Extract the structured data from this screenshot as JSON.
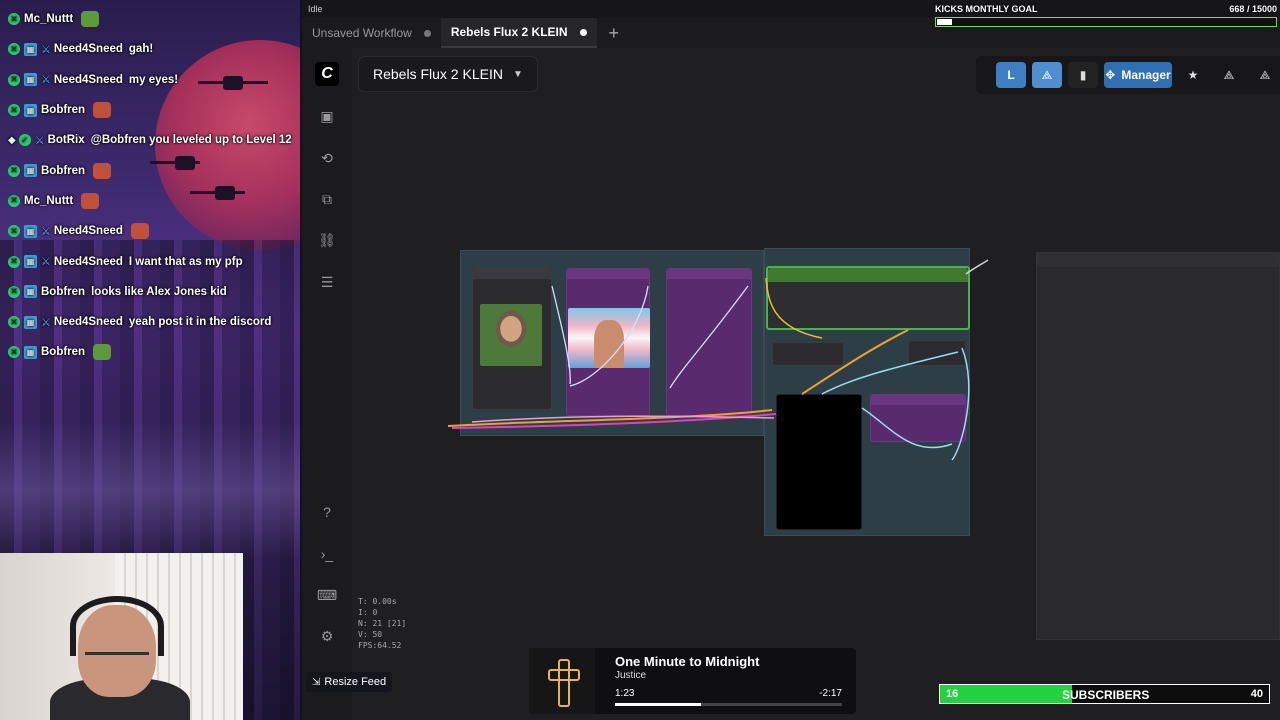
{
  "chat": {
    "messages": [
      {
        "user": "Mc_Nuttt",
        "text": "",
        "badges": [
          "mod"
        ],
        "emote": "green"
      },
      {
        "user": "Need4Sneed",
        "text": "gah!",
        "badges": [
          "mod",
          "sub",
          "sword"
        ]
      },
      {
        "user": "Need4Sneed",
        "text": "my eyes!",
        "badges": [
          "mod",
          "sub",
          "sword"
        ]
      },
      {
        "user": "Bobfren",
        "text": "",
        "badges": [
          "mod",
          "sub"
        ],
        "emote": "red"
      },
      {
        "user": "BotRix",
        "text": "@Bobfren you leveled up to Level 12",
        "badges": [
          "bot",
          "verified",
          "sword"
        ]
      },
      {
        "user": "Bobfren",
        "text": "",
        "badges": [
          "mod",
          "sub"
        ],
        "emote": "red"
      },
      {
        "user": "Mc_Nuttt",
        "text": "",
        "badges": [
          "mod"
        ],
        "emote": "red"
      },
      {
        "user": "Need4Sneed",
        "text": "",
        "badges": [
          "mod",
          "sub",
          "sword"
        ],
        "emote": "red"
      },
      {
        "user": "Need4Sneed",
        "text": "I want that as my pfp",
        "badges": [
          "mod",
          "sub",
          "sword"
        ]
      },
      {
        "user": "Bobfren",
        "text": "looks like Alex Jones kid",
        "badges": [
          "mod",
          "sub"
        ]
      },
      {
        "user": "Need4Sneed",
        "text": "yeah post it in the discord",
        "badges": [
          "mod",
          "sub",
          "sword"
        ]
      },
      {
        "user": "Bobfren",
        "text": "",
        "badges": [
          "mod",
          "sub"
        ],
        "emote": "green"
      }
    ]
  },
  "resize_feed": {
    "label": "Resize Feed"
  },
  "app": {
    "status": "Idle",
    "tabs": [
      {
        "label": "Unsaved Workflow",
        "active": false
      },
      {
        "label": "Rebels Flux 2 KLEIN",
        "active": true
      }
    ],
    "workflow_title": "Rebels Flux 2 KLEIN",
    "topbar": {
      "l_label": "L",
      "manager_label": "Manager"
    },
    "stats": [
      "T: 0.00s",
      "I: 0",
      "N: 21 [21]",
      "V: 50",
      "FPS:64.52"
    ]
  },
  "goal": {
    "title": "KICKS MONTHLY GOAL",
    "current": "668",
    "target": "/ 15000",
    "progress": 0.045
  },
  "music": {
    "title": "One Minute to Midnight",
    "artist": "Justice",
    "elapsed": "1:23",
    "remaining": "-2:17",
    "progress": 0.38
  },
  "subs": {
    "count": "16",
    "label": "SUBSCRIBERS",
    "goal": "40",
    "progress": 0.4
  },
  "colors": {
    "accent": "#2f6fb4",
    "subs_bar": "#21d33c",
    "node_purple": "#5a2a6e",
    "group_teal": "#2d3e47"
  }
}
